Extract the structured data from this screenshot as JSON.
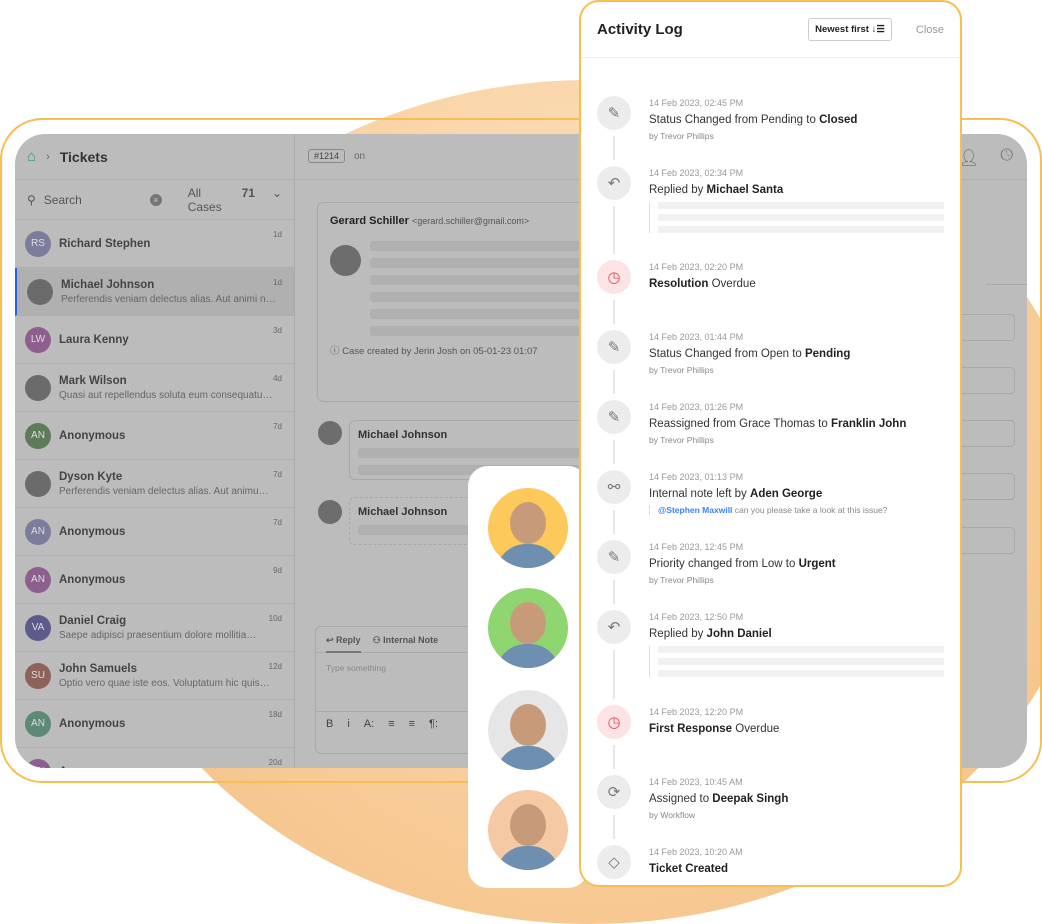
{
  "colors": {
    "accent": "#f7bf50",
    "overdue": "#e5485b",
    "mention": "#3b82f6",
    "selected": "#2563eb"
  },
  "tickets": {
    "breadcrumb": "Tickets",
    "search_placeholder": "Search",
    "filter_label": "All Cases",
    "filter_count": "71",
    "items": [
      {
        "initials": "RS",
        "name": "Richard Stephen",
        "preview": "",
        "age": "1d",
        "color": "#7c7d9c"
      },
      {
        "initials": "",
        "name": "Michael Johnson",
        "preview": "Perferendis veniam delectus alias. Aut animi neq…",
        "age": "1d",
        "color": "#6b6b6b",
        "selected": true
      },
      {
        "initials": "LW",
        "name": "Laura Kenny",
        "preview": "",
        "age": "3d",
        "color": "#8c5f8f"
      },
      {
        "initials": "",
        "name": "Mark Wilson",
        "preview": "Quasi aut repellendus soluta eum consequatur…",
        "age": "4d",
        "color": "#6b6b6b"
      },
      {
        "initials": "AN",
        "name": "Anonymous",
        "preview": "",
        "age": "7d",
        "color": "#5e7a5a"
      },
      {
        "initials": "",
        "name": "Dyson Kyte",
        "preview": "Perferendis veniam delectus alias. Aut animue…",
        "age": "7d",
        "color": "#6b6b6b"
      },
      {
        "initials": "AN",
        "name": "Anonymous",
        "preview": "",
        "age": "7d",
        "color": "#7c7d9c"
      },
      {
        "initials": "AN",
        "name": "Anonymous",
        "preview": "",
        "age": "9d",
        "color": "#8c5f8f"
      },
      {
        "initials": "VA",
        "name": "Daniel Craig",
        "preview": "Saepe adipisci praesentium dolore mollitia…",
        "age": "10d",
        "color": "#5d5a8c"
      },
      {
        "initials": "SU",
        "name": "John Samuels",
        "preview": "Optio vero quae iste eos. Voluptatum hic quis…",
        "age": "12d",
        "color": "#8e615a"
      },
      {
        "initials": "AN",
        "name": "Anonymous",
        "preview": "",
        "age": "18d",
        "color": "#5d8a76"
      },
      {
        "initials": "AN",
        "name": "Anonymous",
        "preview": "",
        "age": "20d",
        "color": "#8c5f8f"
      }
    ]
  },
  "conversation": {
    "ticket_id": "#1214",
    "on": "on",
    "sender": "Gerard Schiller",
    "email": "<gerard.schiller@gmail.com>",
    "created_note": "Case created by Jerin Josh on 05-01-23 01:07",
    "reply1": "Michael Johnson",
    "reply2": "Michael Johnson",
    "composer": {
      "tab_reply": "Reply",
      "tab_note": "Internal Note",
      "placeholder": "Type something",
      "tools": [
        "B",
        "i",
        "A:",
        "≡",
        "≡",
        "¶:"
      ]
    }
  },
  "activity": {
    "title": "Activity Log",
    "sort_label": "Newest first",
    "close_label": "Close",
    "items": [
      {
        "icon": "pencil-icon",
        "time": "14 Feb 2023, 02:45 PM",
        "pre": "Status Changed from Pending to ",
        "bold": "Closed",
        "post": "",
        "by": "by Trevor Phillips"
      },
      {
        "icon": "reply-icon",
        "time": "14 Feb 2023, 02:34 PM",
        "pre": "Replied by ",
        "bold": "Michael Santa",
        "post": "",
        "quote": true
      },
      {
        "icon": "overdue-clock-icon",
        "time": "14 Feb 2023, 02:20 PM",
        "pre": "",
        "bold": "Resolution",
        "post": " Overdue",
        "red": true
      },
      {
        "icon": "pencil-icon",
        "time": "14 Feb 2023, 01:44 PM",
        "pre": "Status Changed from Open to ",
        "bold": "Pending",
        "post": "",
        "by": "by Trevor Phillips"
      },
      {
        "icon": "pencil-icon",
        "time": "14 Feb 2023, 01:26 PM",
        "pre": "Reassigned from Grace Thomas to ",
        "bold": "Franklin John",
        "post": "",
        "by": "by Trevor Phillips"
      },
      {
        "icon": "incognito-icon",
        "time": "14 Feb 2023, 01:13 PM",
        "pre": "Internal note left by ",
        "bold": "Aden George",
        "post": "",
        "mention": "@Stephen Maxwill",
        "note": " can you please take a look at this issue?"
      },
      {
        "icon": "pencil-icon",
        "time": "14 Feb 2023, 12:45 PM",
        "pre": "Priority changed from Low to ",
        "bold": "Urgent",
        "post": "",
        "by": "by Trevor Phillips"
      },
      {
        "icon": "reply-icon",
        "time": "14 Feb 2023, 12:50 PM",
        "pre": "Replied by ",
        "bold": "John Daniel",
        "post": "",
        "quote": true
      },
      {
        "icon": "overdue-clock-icon",
        "time": "14 Feb 2023, 12:20 PM",
        "pre": "",
        "bold": "First Response",
        "post": " Overdue",
        "red": true
      },
      {
        "icon": "workflow-icon",
        "time": "14 Feb 2023, 10:45 AM",
        "pre": "Assigned to ",
        "bold": "Deepak Singh",
        "post": "",
        "by": "by Workflow"
      },
      {
        "icon": "ticket-icon",
        "time": "14 Feb 2023, 10:20 AM",
        "pre": "",
        "bold": "Ticket Created",
        "post": ""
      }
    ]
  },
  "people": [
    {
      "bg": "#fcc95a"
    },
    {
      "bg": "#8fd671"
    },
    {
      "bg": "#e6e6e6"
    },
    {
      "bg": "#f5c9a3"
    }
  ]
}
